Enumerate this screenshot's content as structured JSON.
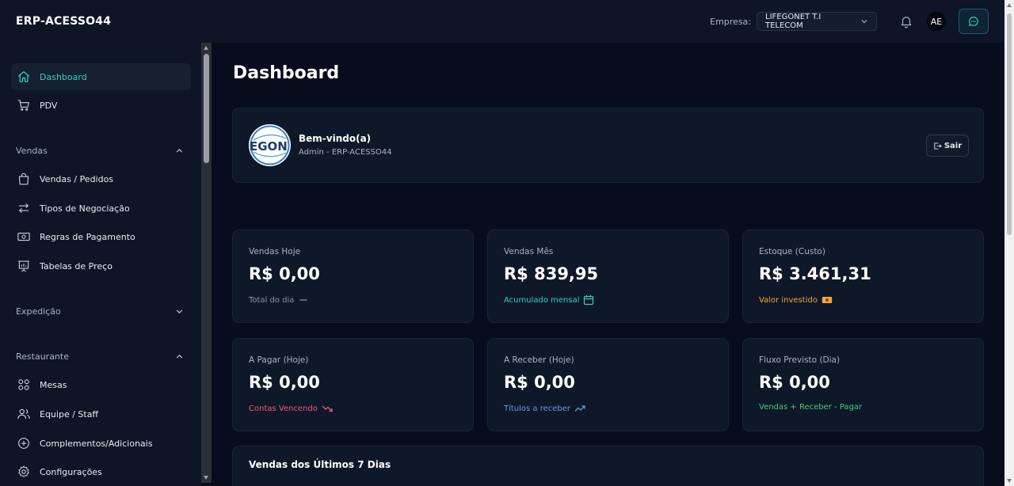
{
  "app": {
    "title": "ERP-ACESSO44"
  },
  "topbar": {
    "empresa_label": "Empresa:",
    "empresa_selected": "LIFEGONET T.I TELECOM",
    "avatar_initials": "AE"
  },
  "sidebar": {
    "top_items": [
      {
        "label": "Dashboard",
        "icon": "home-icon",
        "active": true
      },
      {
        "label": "PDV",
        "icon": "cart-icon"
      }
    ],
    "sections": [
      {
        "label": "Vendas",
        "expanded": true,
        "items": [
          {
            "label": "Vendas / Pedidos",
            "icon": "bag-icon"
          },
          {
            "label": "Tipos de Negociação",
            "icon": "arrows-swap-icon"
          },
          {
            "label": "Regras de Pagamento",
            "icon": "banknote-icon"
          },
          {
            "label": "Tabelas de Preço",
            "icon": "presentation-icon"
          }
        ]
      },
      {
        "label": "Expedição",
        "expanded": false,
        "items": []
      },
      {
        "label": "Restaurante",
        "expanded": true,
        "items": [
          {
            "label": "Mesas",
            "icon": "grid-circles-icon"
          },
          {
            "label": "Equipe / Staff",
            "icon": "users-icon"
          },
          {
            "label": "Complementos/Adicionais",
            "icon": "plus-circle-icon"
          },
          {
            "label": "Configurações",
            "icon": "gear-icon"
          }
        ]
      }
    ]
  },
  "main": {
    "title": "Dashboard",
    "welcome": {
      "title": "Bem-vindo(a)",
      "subtitle": "Admin - ERP-ACESSO44",
      "logo_text": "EGON",
      "logout_label": "Sair"
    },
    "cards": [
      {
        "label": "Vendas Hoje",
        "value": "R$ 0,00",
        "note": "Total do dia",
        "icon": "dash-icon",
        "note_color": "#8a93a3"
      },
      {
        "label": "Vendas Mês",
        "value": "R$ 839,95",
        "note": "Acumulado mensal",
        "icon": "calendar-icon",
        "note_color": "#2fd3c0"
      },
      {
        "label": "Estoque (Custo)",
        "value": "R$ 3.461,31",
        "note": "Valor investido",
        "icon": "cash-icon",
        "note_color": "#f0a53a"
      },
      {
        "label": "A Pagar (Hoje)",
        "value": "R$ 0,00",
        "note": "Contas Vencendo",
        "icon": "trend-down-icon",
        "note_color": "#ef5b6a"
      },
      {
        "label": "A Receber (Hoje)",
        "value": "R$ 0,00",
        "note": "Títulos a receber",
        "icon": "trend-up-icon",
        "note_color": "#5b9cf0"
      },
      {
        "label": "Fluxo Previsto (Dia)",
        "value": "R$ 0,00",
        "note": "Vendas + Receber - Pagar",
        "icon": "",
        "note_color": "#3fcf7a"
      }
    ],
    "chart_section_title": "Vendas dos Últimos 7 Dias"
  },
  "colors": {
    "accent": "#2fd3c0",
    "background": "#070d1c",
    "surface": "#0f1829"
  }
}
